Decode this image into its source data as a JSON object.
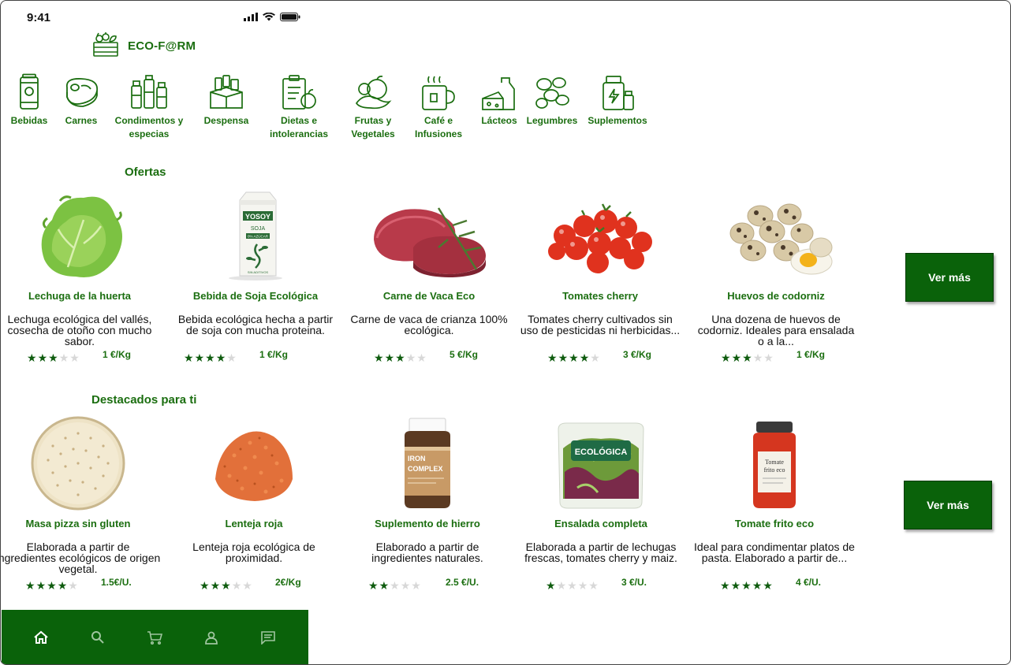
{
  "status": {
    "time": "9:41"
  },
  "brand": {
    "name": "ECO-F@RM"
  },
  "categories": [
    {
      "label": "Bebidas",
      "icon": "drink-can-icon"
    },
    {
      "label": "Carnes",
      "icon": "steak-icon"
    },
    {
      "label": "Condimentos y especias",
      "icon": "spices-icon"
    },
    {
      "label": "Despensa",
      "icon": "pantry-box-icon"
    },
    {
      "label": "Dietas e intolerancias",
      "icon": "diet-clipboard-icon"
    },
    {
      "label": "Frutas y Vegetales",
      "icon": "fruits-vegetables-icon"
    },
    {
      "label": "Café e Infusiones",
      "icon": "coffee-cup-icon"
    },
    {
      "label": "Lácteos",
      "icon": "dairy-icon"
    },
    {
      "label": "Legumbres",
      "icon": "beans-icon"
    },
    {
      "label": "Suplementos",
      "icon": "supplements-icon"
    }
  ],
  "sections": {
    "offers": {
      "title": "Ofertas",
      "more": "Ver más",
      "products": [
        {
          "name": "Lechuga de la huerta",
          "desc": "Lechuga ecológica del vallés, cosecha de otoño con mucho sabor.",
          "rating": 3,
          "price": "1 €/Kg",
          "image": "lettuce"
        },
        {
          "name": "Bebida de Soja Ecológica",
          "desc": "Bebida ecológica hecha a partir de soja con mucha proteina.",
          "rating": 4,
          "price": "1 €/Kg",
          "image": "soy-drink-carton"
        },
        {
          "name": "Carne de Vaca Eco",
          "desc": "Carne de vaca de crianza 100% ecológica.",
          "rating": 3,
          "price": "5 €/Kg",
          "image": "beef-steak"
        },
        {
          "name": "Tomates cherry",
          "desc": "Tomates cherry cultivados sin uso de pesticidas ni herbicidas...",
          "rating": 4,
          "price": "3 €/Kg",
          "image": "cherry-tomatoes"
        },
        {
          "name": "Huevos de codorniz",
          "desc": "Una dozena de huevos de codorniz. Ideales para ensalada o a la...",
          "rating": 3,
          "price": "1 €/Kg",
          "image": "quail-eggs"
        }
      ]
    },
    "featured": {
      "title": "Destacados para ti",
      "more": "Ver más",
      "products": [
        {
          "name": "Masa pizza sin gluten",
          "desc": "Elaborada a partir de ingredientes ecológicos de origen vegetal.",
          "rating": 4,
          "price": "1.5€/U.",
          "image": "pizza-base"
        },
        {
          "name": "Lenteja roja",
          "desc": "Lenteja roja ecológica de proximidad.",
          "rating": 3,
          "price": "2€/Kg",
          "image": "red-lentils"
        },
        {
          "name": "Suplemento de hierro",
          "desc": "Elaborado a partir de ingredientes naturales.",
          "rating": 2,
          "price": "2.5 €/U.",
          "image": "iron-supplement-jar",
          "label_lines": [
            "IRON",
            "COMPLEX"
          ]
        },
        {
          "name": "Ensalada completa",
          "desc": "Elaborada a partir de lechugas frescas, tomates cherry y maiz.",
          "rating": 1,
          "price": "3 €/U.",
          "image": "salad-bag",
          "label_lines": [
            "ECOLÓGICA"
          ]
        },
        {
          "name": "Tomate frito eco",
          "desc": "Ideal para condimentar platos de pasta. Elaborado a partir de...",
          "rating": 5,
          "price": "4 €/U.",
          "image": "tomato-sauce-jar",
          "label_lines": [
            "Tomate",
            "frito eco"
          ]
        }
      ]
    }
  },
  "soy_pack": {
    "brand": "YOSOY",
    "line1": "SOJA",
    "line2": "0% AZÚCAR",
    "line3": "SIN ADITIVOS"
  },
  "tabbar": [
    {
      "icon": "home-icon"
    },
    {
      "icon": "search-icon"
    },
    {
      "icon": "cart-icon"
    },
    {
      "icon": "profile-icon"
    },
    {
      "icon": "chat-icon"
    }
  ],
  "colors": {
    "brand_green": "#1b6e10",
    "button_green": "#0a620a",
    "star_on": "#0f5c0f",
    "star_off": "#d8d8d8"
  }
}
